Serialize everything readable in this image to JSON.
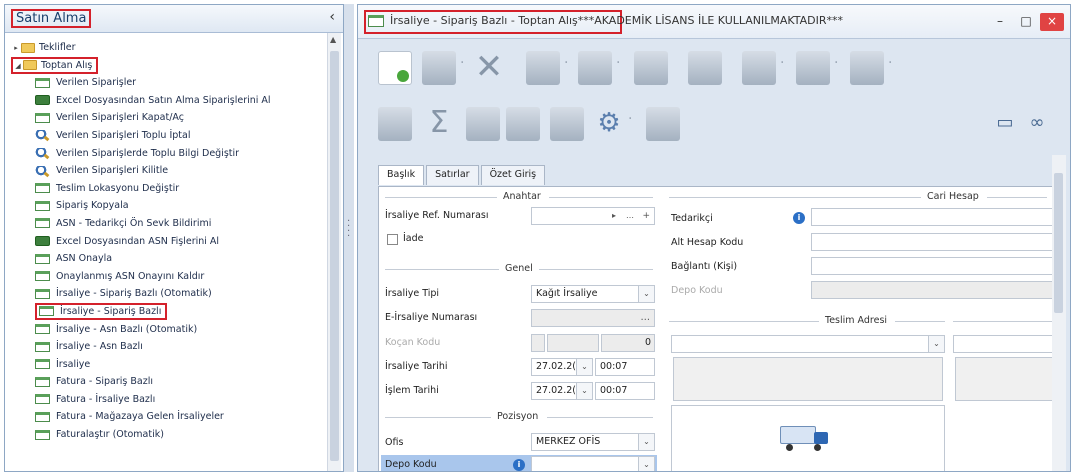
{
  "left_panel": {
    "title": "Satın Alma",
    "collapse_glyph": "‹",
    "tree": {
      "teklifler": "Teklifler",
      "toptan_alis": "Toptan Alış",
      "items": [
        {
          "label": "Verilen Siparişler",
          "icon": "form-icon"
        },
        {
          "label": "Excel Dosyasından Satın Alma Siparişlerini Al",
          "icon": "excel-icon"
        },
        {
          "label": "Verilen Siparişleri Kapat/Aç",
          "icon": "form-icon"
        },
        {
          "label": "Verilen Siparişleri Toplu İptal",
          "icon": "magnifier-icon"
        },
        {
          "label": "Verilen Siparişlerde Toplu Bilgi Değiştir",
          "icon": "magnifier-icon"
        },
        {
          "label": "Verilen Siparişleri Kilitle",
          "icon": "magnifier-icon"
        },
        {
          "label": "Teslim Lokasyonu Değiştir",
          "icon": "form-icon"
        },
        {
          "label": "Sipariş Kopyala",
          "icon": "form-icon"
        },
        {
          "label": "ASN - Tedarikçi Ön Sevk Bildirimi",
          "icon": "form-icon"
        },
        {
          "label": "Excel Dosyasından ASN Fişlerini Al",
          "icon": "excel-icon"
        },
        {
          "label": "ASN Onayla",
          "icon": "form-icon"
        },
        {
          "label": "Onaylanmış ASN Onayını Kaldır",
          "icon": "form-icon"
        },
        {
          "label": "İrsaliye - Sipariş Bazlı (Otomatik)",
          "icon": "form-icon"
        },
        {
          "label": "İrsaliye - Sipariş Bazlı",
          "icon": "form-icon",
          "highlighted": true
        },
        {
          "label": "İrsaliye - Asn Bazlı (Otomatik)",
          "icon": "form-icon"
        },
        {
          "label": "İrsaliye - Asn Bazlı",
          "icon": "form-icon"
        },
        {
          "label": "İrsaliye",
          "icon": "form-icon"
        },
        {
          "label": "Fatura - Sipariş Bazlı",
          "icon": "form-icon"
        },
        {
          "label": "Fatura - İrsaliye Bazlı",
          "icon": "form-icon"
        },
        {
          "label": "Fatura - Mağazaya Gelen İrsaliyeler",
          "icon": "form-icon"
        },
        {
          "label": "Faturalaştır (Otomatik)",
          "icon": "form-icon"
        }
      ]
    }
  },
  "window": {
    "title_highlighted": "İrsaliye - Sipariş Bazlı - Toptan Alış",
    "title_rest": "***AKADEMİK LİSANS İLE KULLANILMAKTADIR***",
    "minimize": "–",
    "maximize": "□",
    "close": "×"
  },
  "tabs": [
    "Başlık",
    "Satırlar",
    "Özet Giriş"
  ],
  "form": {
    "anahtar_group": "Anahtar",
    "irsaliye_ref_label": "İrsaliye Ref. Numarası",
    "iade_label": "İade",
    "genel_group": "Genel",
    "irsaliye_tipi_label": "İrsaliye Tipi",
    "irsaliye_tipi_value": "Kağıt İrsaliye",
    "e_irsaliye_label": "E-İrsaliye Numarası",
    "kocan_label": "Koçan Kodu",
    "kocan_value": "0",
    "irsaliye_tarihi_label": "İrsaliye Tarihi",
    "irsaliye_tarihi_date": "27.02.2(",
    "irsaliye_tarihi_time": "00:07",
    "islem_tarihi_label": "İşlem Tarihi",
    "islem_tarihi_date": "27.02.2(",
    "islem_tarihi_time": "00:07",
    "pozisyon_group": "Pozisyon",
    "ofis_label": "Ofis",
    "ofis_value": "MERKEZ OFİS",
    "depo_label": "Depo Kodu",
    "cari_group": "Cari Hesap",
    "tedarikci_label": "Tedarikçi",
    "alt_hesap_label": "Alt Hesap Kodu",
    "baglanti_label": "Bağlantı (Kişi)",
    "depo_kodu_right_label": "Depo Kodu",
    "teslim_group": "Teslim Adresi"
  },
  "colors": {
    "highlight": "#d4212b",
    "accent": "#2b6fc6"
  }
}
